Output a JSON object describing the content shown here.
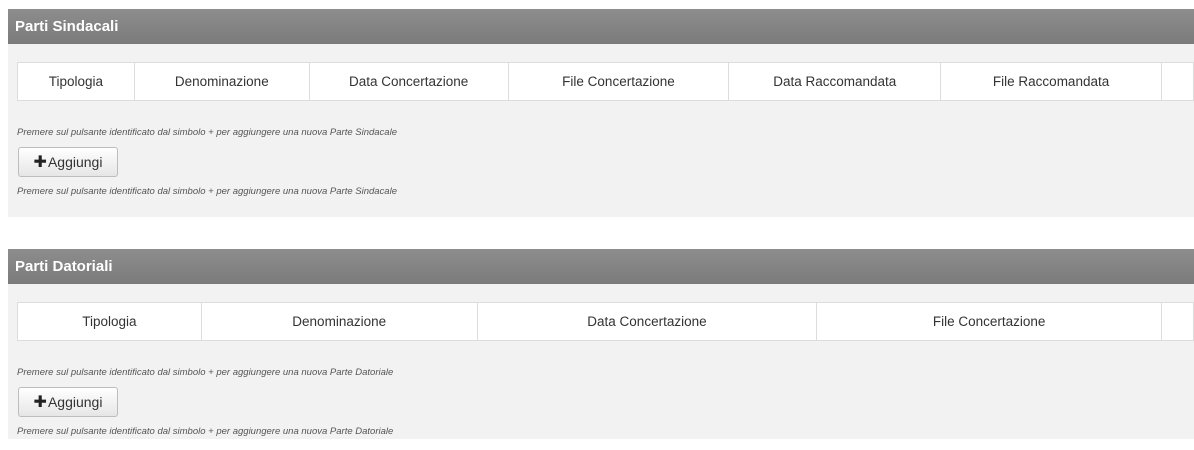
{
  "sindacali": {
    "title": "Parti Sindacali",
    "columns": [
      "Tipologia",
      "Denominazione",
      "Data Concertazione",
      "File Concertazione",
      "Data Raccomandata",
      "File Raccomandata",
      ""
    ],
    "hint_top": "Premere sul pulsante identificato dal simbolo + per aggiungere una nuova Parte Sindacale",
    "add_label": "Aggiungi",
    "hint_bottom": "Premere sul pulsante identificato dal simbolo + per aggiungere una nuova Parte Sindacale"
  },
  "datoriali": {
    "title": "Parti Datoriali",
    "columns": [
      "Tipologia",
      "Denominazione",
      "Data Concertazione",
      "File Concertazione",
      ""
    ],
    "hint_top": "Premere sul pulsante identificato dal simbolo + per aggiungere una nuova Parte Datoriale",
    "add_label": "Aggiungi",
    "hint_bottom": "Premere sul pulsante identificato dal simbolo + per aggiungere una nuova Parte Datoriale"
  },
  "icons": {
    "add": "plus-icon"
  }
}
